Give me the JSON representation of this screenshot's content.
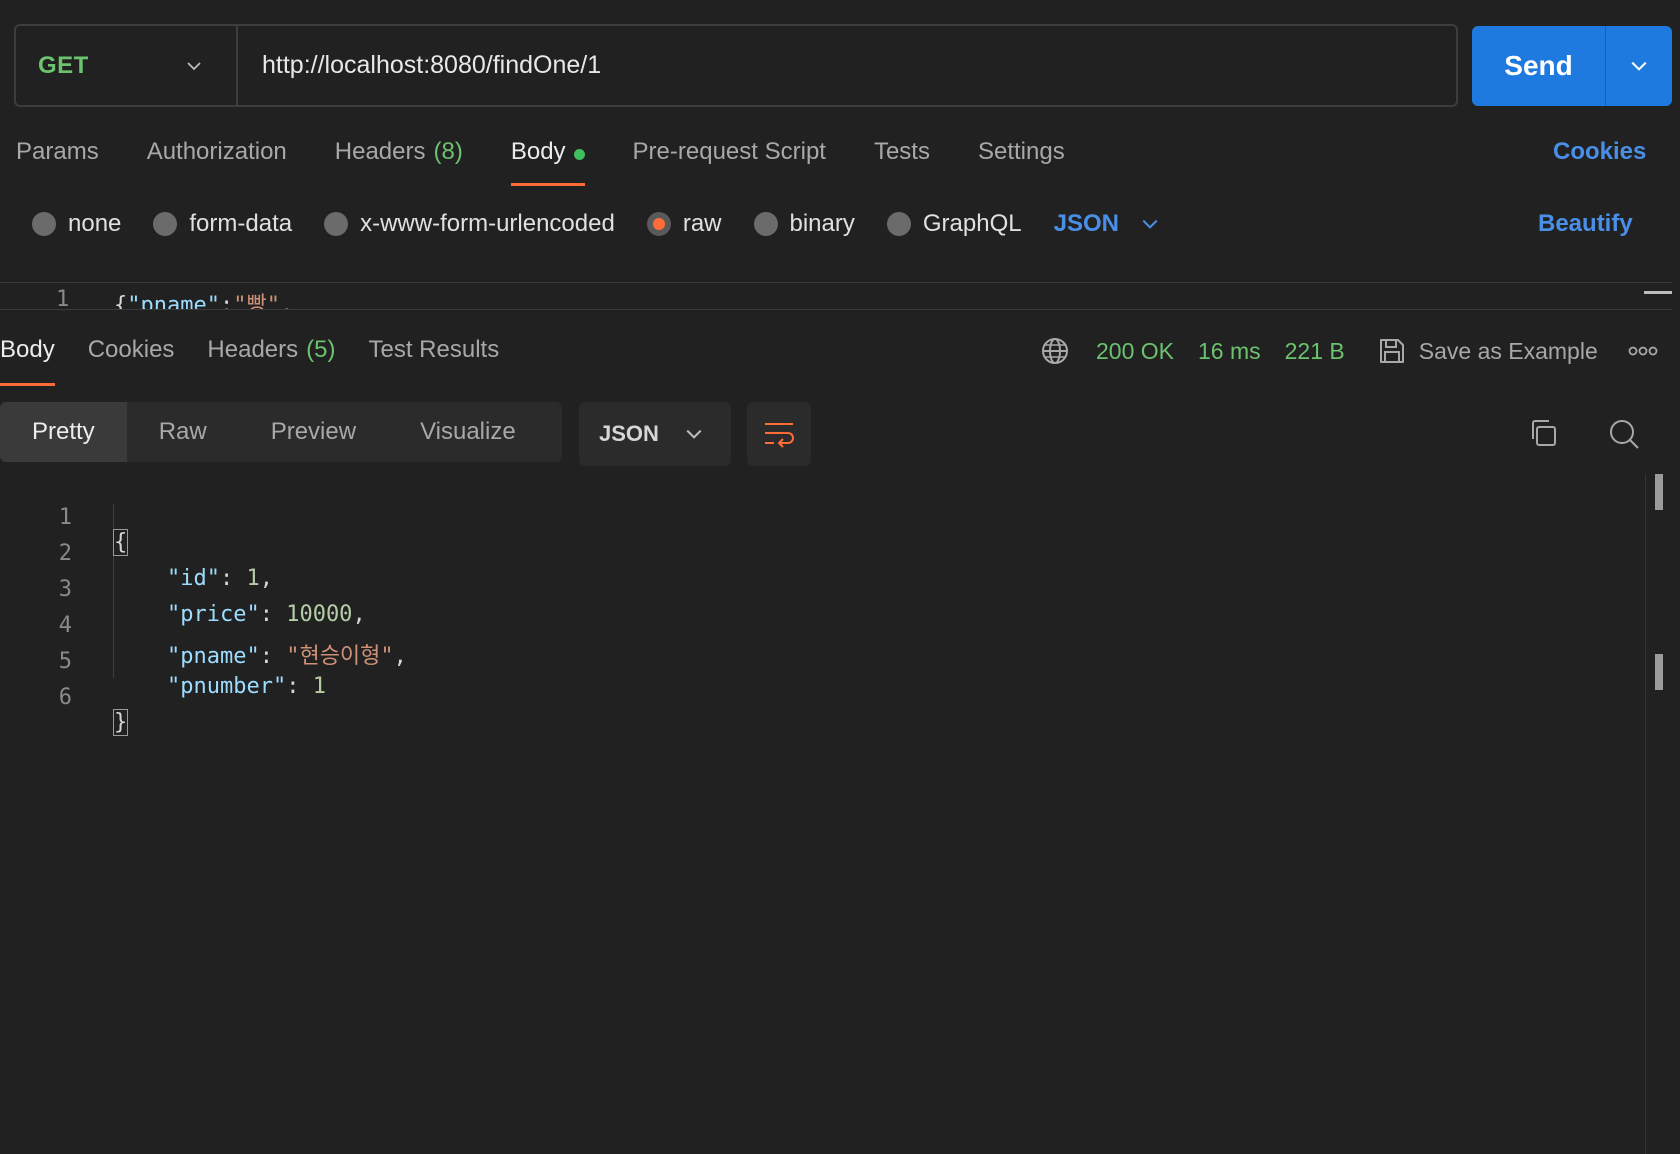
{
  "request": {
    "method": "GET",
    "url": "http://localhost:8080/findOne/1",
    "send_label": "Send"
  },
  "request_tabs": [
    {
      "label": "Params"
    },
    {
      "label": "Authorization"
    },
    {
      "label": "Headers",
      "count": "(8)"
    },
    {
      "label": "Body",
      "active": true
    },
    {
      "label": "Pre-request Script"
    },
    {
      "label": "Tests"
    },
    {
      "label": "Settings"
    }
  ],
  "cookies_link": "Cookies",
  "body_types": [
    {
      "label": "none"
    },
    {
      "label": "form-data"
    },
    {
      "label": "x-www-form-urlencoded"
    },
    {
      "label": "raw",
      "selected": true
    },
    {
      "label": "binary"
    },
    {
      "label": "GraphQL"
    }
  ],
  "body_format": "JSON",
  "beautify_label": "Beautify",
  "request_editor": {
    "line_number": "1",
    "brace": "{",
    "key": "\"pname\"",
    "colon": ":",
    "value": "\"빵\"",
    "trail": ","
  },
  "response_tabs": [
    {
      "label": "Body",
      "active": true
    },
    {
      "label": "Cookies"
    },
    {
      "label": "Headers",
      "count": "(5)"
    },
    {
      "label": "Test Results"
    }
  ],
  "response_meta": {
    "status": "200 OK",
    "time": "16 ms",
    "size": "221 B",
    "save_example": "Save as Example"
  },
  "view_modes": [
    {
      "label": "Pretty",
      "active": true
    },
    {
      "label": "Raw"
    },
    {
      "label": "Preview"
    },
    {
      "label": "Visualize"
    }
  ],
  "response_format": "JSON",
  "response_body": {
    "lines": [
      "1",
      "2",
      "3",
      "4",
      "5",
      "6"
    ],
    "open_brace": "{",
    "close_brace": "}",
    "fields": [
      {
        "key": "\"id\"",
        "value": "1",
        "type": "number"
      },
      {
        "key": "\"price\"",
        "value": "10000",
        "type": "number"
      },
      {
        "key": "\"pname\"",
        "value": "\"현승이형\"",
        "type": "string"
      },
      {
        "key": "\"pnumber\"",
        "value": "1",
        "type": "number"
      }
    ]
  },
  "colors": {
    "accent": "#ff6c37",
    "primary": "#1f7ae0",
    "success": "#6cc26f",
    "link": "#4a8fe7"
  },
  "icons": [
    "chevron-down-icon",
    "globe-icon",
    "save-icon",
    "more-icon",
    "wrap-lines-icon",
    "copy-icon",
    "search-icon"
  ]
}
